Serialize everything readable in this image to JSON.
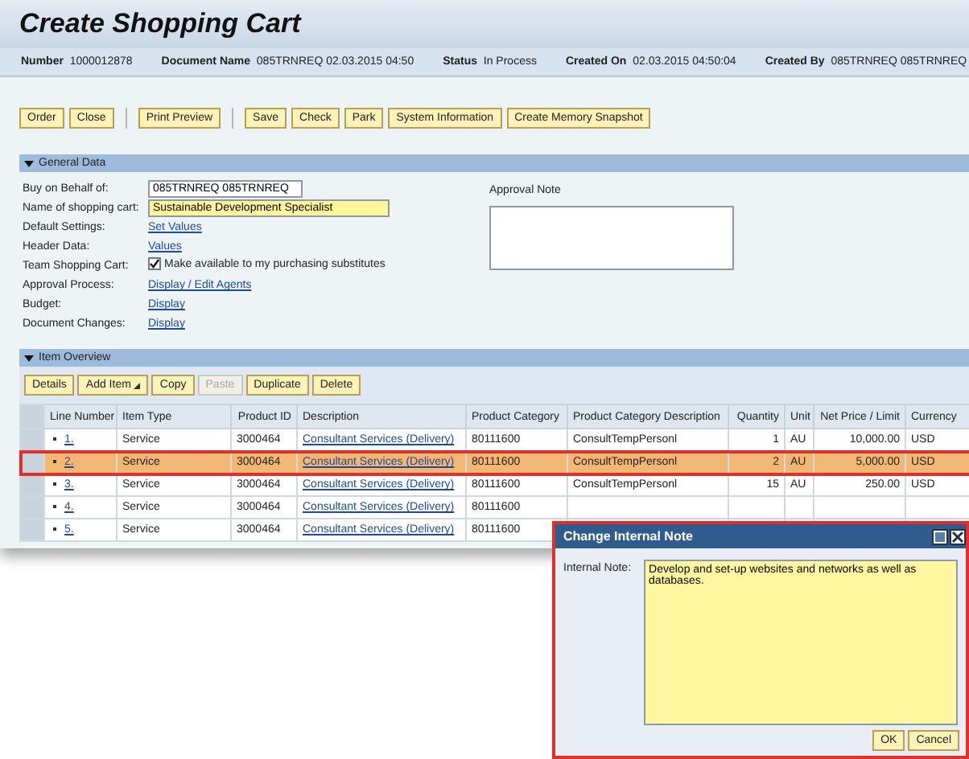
{
  "title": "Create Shopping Cart",
  "header_fields": [
    {
      "label": "Number",
      "value": "1000012878"
    },
    {
      "label": "Document Name",
      "value": "085TRNREQ 02.03.2015 04:50"
    },
    {
      "label": "Status",
      "value": "In Process"
    },
    {
      "label": "Created On",
      "value": "02.03.2015 04:50:04"
    },
    {
      "label": "Created By",
      "value": "085TRNREQ 085TRNREQ"
    }
  ],
  "toolbar": [
    [
      "Order",
      "Close"
    ],
    [
      "Print Preview"
    ],
    [
      "Save",
      "Check",
      "Park",
      "System Information",
      "Create Memory Snapshot"
    ]
  ],
  "general_data": {
    "title": "General Data",
    "expanded": true,
    "fields": [
      {
        "kind": "input",
        "label": "Buy on Behalf of:",
        "value": "085TRNREQ 085TRNREQ",
        "highlighted": false
      },
      {
        "kind": "input",
        "label": "Name of shopping cart:",
        "value": "Sustainable Development Specialist",
        "highlighted": true
      },
      {
        "kind": "link",
        "label": "Default Settings:",
        "value": "Set Values"
      },
      {
        "kind": "link",
        "label": "Header Data:",
        "value": "Values"
      },
      {
        "kind": "checkbox",
        "label": "Team Shopping Cart:",
        "value": "Make available to my purchasing substitutes",
        "checked": true
      },
      {
        "kind": "link",
        "label": "Approval Process:",
        "value": "Display / Edit Agents"
      },
      {
        "kind": "link",
        "label": "Budget:",
        "value": "Display"
      },
      {
        "kind": "link",
        "label": "Document Changes:",
        "value": "Display"
      }
    ],
    "approval_note": {
      "label": "Approval Note"
    }
  },
  "item_overview": {
    "title": "Item Overview",
    "expanded": true,
    "buttons": [
      {
        "label": "Details",
        "disabled": false,
        "menu": false
      },
      {
        "label": "Add Item",
        "disabled": false,
        "menu": true
      },
      {
        "label": "Copy",
        "disabled": false,
        "menu": false
      },
      {
        "label": "Paste",
        "disabled": true,
        "menu": false
      },
      {
        "label": "Duplicate",
        "disabled": false,
        "menu": false
      },
      {
        "label": "Delete",
        "disabled": false,
        "menu": false
      }
    ],
    "columns": [
      "Line Number",
      "Item Type",
      "Product ID",
      "Description",
      "Product Category",
      "Product Category Description",
      "Quantity",
      "Unit",
      "Net Price / Limit",
      "Currency"
    ],
    "rows": [
      {
        "selected": false,
        "cells": [
          "1.",
          "Service",
          "3000464",
          "Consultant Services (Delivery)",
          "80111600",
          "ConsultTempPersonl",
          "1",
          "AU",
          "10,000.00",
          "USD"
        ]
      },
      {
        "selected": true,
        "cells": [
          "2.",
          "Service",
          "3000464",
          "Consultant Services (Delivery)",
          "80111600",
          "ConsultTempPersonl",
          "2",
          "AU",
          "5,000.00",
          "USD"
        ]
      },
      {
        "selected": false,
        "cells": [
          "3.",
          "Service",
          "3000464",
          "Consultant Services (Delivery)",
          "80111600",
          "ConsultTempPersonl",
          "15",
          "AU",
          "250.00",
          "USD"
        ]
      },
      {
        "selected": false,
        "cells": [
          "4.",
          "Service",
          "3000464",
          "Consultant Services (Delivery)",
          "80111600"
        ]
      },
      {
        "selected": false,
        "cells": [
          "5.",
          "Service",
          "3000464",
          "Consultant Services (Delivery)",
          "80111600"
        ]
      }
    ]
  },
  "dialog": {
    "title": "Change Internal Note",
    "label": "Internal Note:",
    "value": "Develop and set-up websites and networks as well as databases.",
    "buttons": [
      "OK",
      "Cancel"
    ]
  }
}
